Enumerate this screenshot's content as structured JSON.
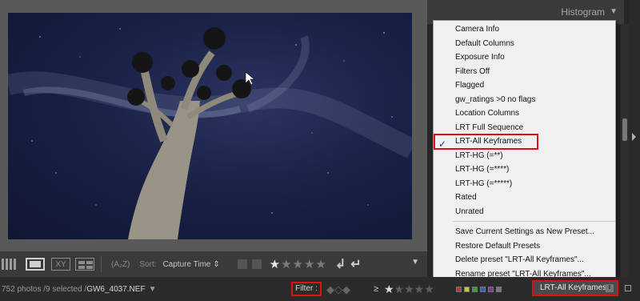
{
  "histogram": {
    "title": "Histogram",
    "arrow_icon": "triangle-down-icon"
  },
  "toolbar": {
    "sort_label": "Sort:",
    "sort_value": "Capture Time ⇕",
    "xy_label": "XY",
    "sort_icon": "(A₂Z)",
    "rotate_left": "↲",
    "rotate_right": "↵",
    "rating_text": "★★★★★"
  },
  "menu": {
    "items": [
      "Camera Info",
      "Default Columns",
      "Exposure Info",
      "Filters Off",
      "Flagged",
      "gw_ratings >0 no flags",
      "Location Columns",
      "LRT Full Sequence",
      "LRT-All Keyframes",
      "LRT-HG (=**)",
      "LRT-HG (=****)",
      "LRT-HG (=*****)",
      "Rated",
      "Unrated"
    ],
    "selected": "LRT-All Keyframes",
    "actions": [
      "Save Current Settings as New Preset...",
      "Restore Default Presets",
      "Delete preset \"LRT-All Keyframes\"...",
      "Rename preset \"LRT-All Keyframes\"..."
    ]
  },
  "filmstrip": {
    "count_text": "752 photos /9 selected /",
    "filename": "GW6_4037.NEF",
    "filter_label": "Filter :",
    "rating_op": "≥",
    "preset_value": "LRT-All Keyframes"
  },
  "colors": {
    "highlight_border": "#dd1111",
    "menu_bg": "#f0f0f0",
    "check": "#1e3a8a",
    "label_red": "#c83232",
    "label_yellow": "#c8c832",
    "label_green": "#32a032",
    "label_blue": "#3264c8",
    "label_purple": "#8c32a0"
  }
}
